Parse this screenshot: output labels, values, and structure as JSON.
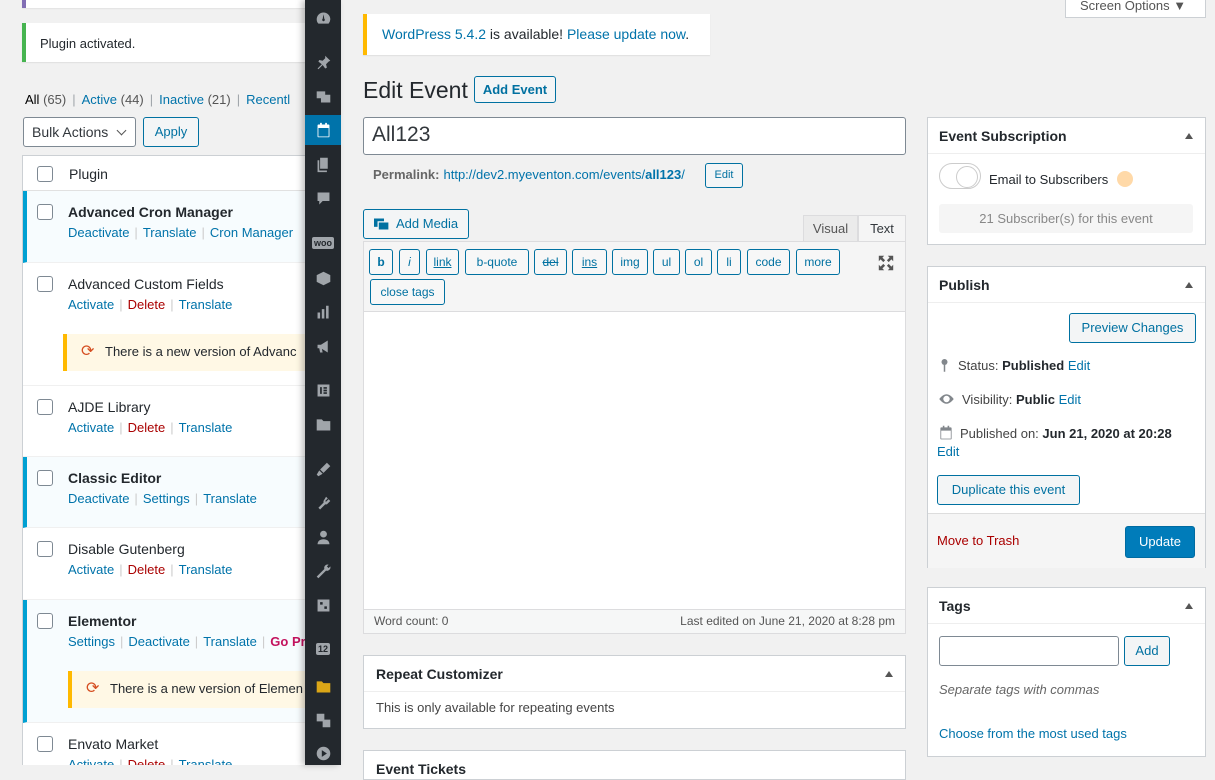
{
  "plugins_panel": {
    "notice": "Plugin activated.",
    "filters": [
      {
        "label": "All",
        "count": "(65)"
      },
      {
        "label": "Active",
        "count": "(44)"
      },
      {
        "label": "Inactive",
        "count": "(21)"
      },
      {
        "label": "Recentl",
        "count": ""
      }
    ],
    "bulk_actions": "Bulk Actions",
    "apply": "Apply",
    "column_header": "Plugin",
    "rows": [
      {
        "name": "Advanced Cron Manager",
        "a1": "Deactivate",
        "a2": "Translate",
        "a3": "Cron Manager"
      },
      {
        "name": "Advanced Custom Fields",
        "a1": "Activate",
        "a2": "Delete",
        "a3": "Translate",
        "update": "There is a new version of Advanc"
      },
      {
        "name": "AJDE Library",
        "a1": "Activate",
        "a2": "Delete",
        "a3": "Translate"
      },
      {
        "name": "Classic Editor",
        "a1": "Deactivate",
        "a2": "Settings",
        "a3": "Translate"
      },
      {
        "name": "Disable Gutenberg",
        "a1": "Activate",
        "a2": "Delete",
        "a3": "Translate"
      },
      {
        "name": "Elementor",
        "a1": "Settings",
        "a2": "Deactivate",
        "a3": "Translate",
        "a4": "Go Pr",
        "update": "There is a new version of Elemen"
      },
      {
        "name": "Envato Market",
        "a1": "Activate",
        "a2": "Delete",
        "a3": "Translate"
      }
    ]
  },
  "admin_menu": {
    "calendar_badge": "12",
    "woo_badge": "woo"
  },
  "update_notice": {
    "version_link": "WordPress 5.4.2",
    "middle": " is available! ",
    "update_link": "Please update now",
    "end": "."
  },
  "screen_options": "Screen Options ▼",
  "editor": {
    "page_title": "Edit Event",
    "add_event": "Add Event",
    "title_value": "All123",
    "permalink_label": "Permalink:",
    "permalink_base": "http://dev2.myeventon.com/events/",
    "permalink_slug": "all123",
    "permalink_end": "/",
    "permalink_edit": "Edit",
    "add_media": "Add Media",
    "tab_visual": "Visual",
    "tab_text": "Text",
    "quicktags": [
      "b",
      "i",
      "link",
      "b-quote",
      "del",
      "ins",
      "img",
      "ul",
      "ol",
      "li",
      "code",
      "more"
    ],
    "close_tags": "close tags",
    "word_count": "Word count: 0",
    "last_edited": "Last edited on June 21, 2020 at 8:28 pm"
  },
  "repeat_customizer": {
    "title": "Repeat Customizer",
    "body": "This is only available for repeating events"
  },
  "event_tickets": {
    "title": "Event Tickets"
  },
  "subscription": {
    "title": "Event Subscription",
    "toggle_label": "Email to Subscribers",
    "count": "21 Subscriber(s) for this event"
  },
  "publish": {
    "title": "Publish",
    "preview": "Preview Changes",
    "status_label": "Status: ",
    "status_value": "Published",
    "status_edit": "Edit",
    "visibility_label": "Visibility: ",
    "visibility_value": "Public",
    "visibility_edit": "Edit",
    "published_label": "Published on: ",
    "published_value": "Jun 21, 2020 at 20:28",
    "published_edit": "Edit",
    "duplicate": "Duplicate this event",
    "trash": "Move to Trash",
    "update": "Update"
  },
  "tags": {
    "title": "Tags",
    "add": "Add",
    "hint": "Separate tags with commas",
    "most_used": "Choose from the most used tags"
  },
  "colors": {
    "accent": "#0073aa",
    "menu_bg": "#23282d",
    "warning": "#ffb900",
    "success": "#46b450",
    "danger": "#a00"
  }
}
